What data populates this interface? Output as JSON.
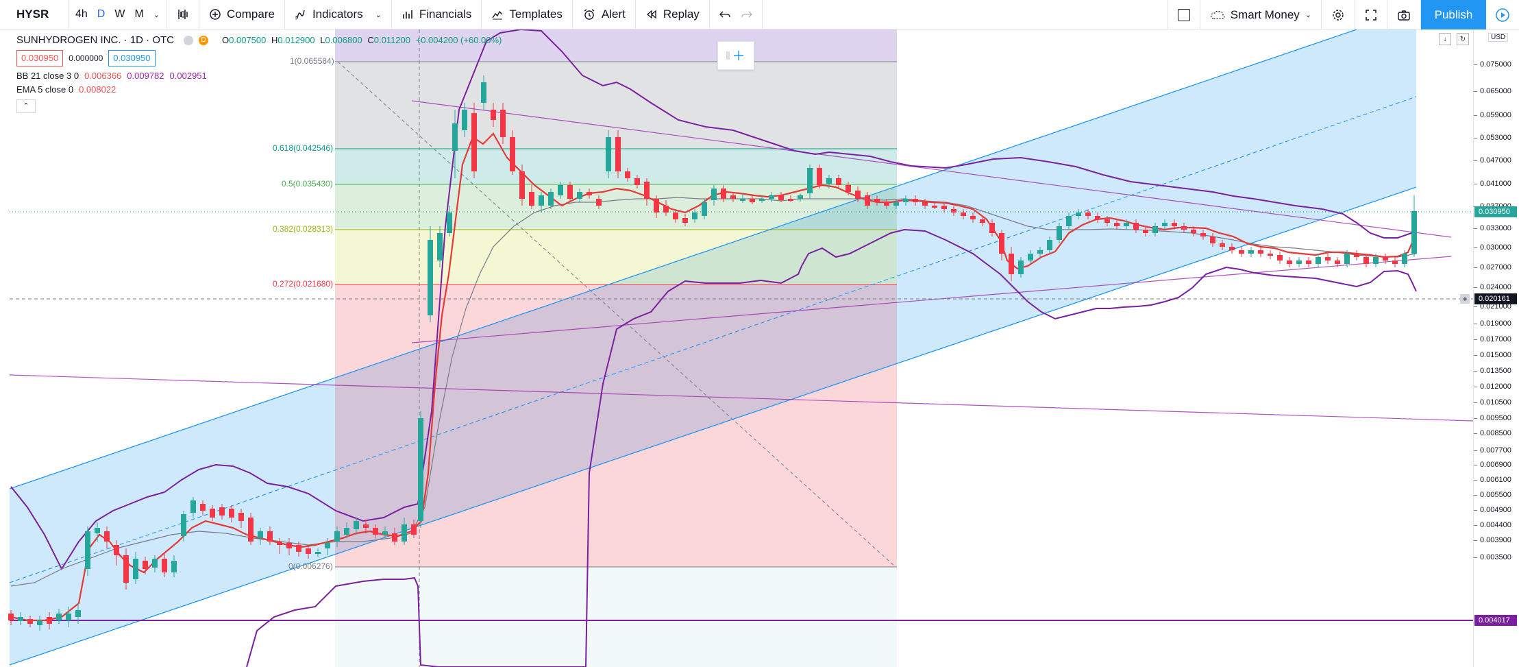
{
  "toolbar": {
    "symbol": "HYSR",
    "timeframes": [
      "4h",
      "D",
      "W",
      "M"
    ],
    "active_timeframe": "D",
    "compare_label": "Compare",
    "indicators_label": "Indicators",
    "financials_label": "Financials",
    "templates_label": "Templates",
    "alert_label": "Alert",
    "replay_label": "Replay",
    "layout_name": "Smart Money",
    "publish_label": "Publish"
  },
  "legend": {
    "title": "SUNHYDROGEN INC. · 1D · OTC",
    "badge": "D",
    "o_label": "O",
    "o_value": "0.007500",
    "h_label": "H",
    "h_value": "0.012900",
    "l_label": "L",
    "l_value": "0.006800",
    "c_label": "C",
    "c_value": "0.011200",
    "change": "+0.004200 (+60.00%)",
    "bid": "0.030950",
    "spread": "0.000000",
    "ask": "0.030950",
    "bb_label": "BB 21 close 3 0",
    "bb_v1": "0.006366",
    "bb_v2": "0.009782",
    "bb_v3": "0.002951",
    "ema_label": "EMA 5 close 0",
    "ema_value": "0.008022"
  },
  "fib_levels": [
    {
      "label": "1(0.065584)",
      "color": "#787b86"
    },
    {
      "label": "0.618(0.042546)",
      "color": "#089981"
    },
    {
      "label": "0.5(0.035430)",
      "color": "#4caf50"
    },
    {
      "label": "0.382(0.028313)",
      "color": "#9eb60f"
    },
    {
      "label": "0.272(0.021680)",
      "color": "#f23645"
    },
    {
      "label": "0(0.006276)",
      "color": "#787b86"
    }
  ],
  "price_scale": {
    "currency": "USD",
    "ticks": [
      "0.075000",
      "0.065000",
      "0.059000",
      "0.053000",
      "0.047000",
      "0.041000",
      "0.037000",
      "0.033000",
      "0.030000",
      "0.027000",
      "0.024000",
      "0.021000",
      "0.019000",
      "0.017000",
      "0.015000",
      "0.013500",
      "0.012000",
      "0.010500",
      "0.009500",
      "0.008500",
      "0.007700",
      "0.006900",
      "0.006100",
      "0.005500",
      "0.004900",
      "0.004400",
      "0.003900",
      "0.003500"
    ],
    "last_price_tag": "0.030950",
    "crosshair_tag": "0.020161",
    "line_tag": "0.004017"
  },
  "colors": {
    "up": "#26a69a",
    "down": "#f23645",
    "channel": "#2196f3",
    "bb": "#7b1fa2",
    "ema": "#e53935",
    "accent": "#2196f3"
  },
  "icons": [
    "bar-style-icon",
    "compare-icon",
    "indicators-icon",
    "financials-icon",
    "templates-icon",
    "alert-icon",
    "replay-icon",
    "undo-icon",
    "redo-icon",
    "layout-icon",
    "settings-icon",
    "fullscreen-icon",
    "camera-icon",
    "play-icon",
    "crosshair-icon"
  ]
}
